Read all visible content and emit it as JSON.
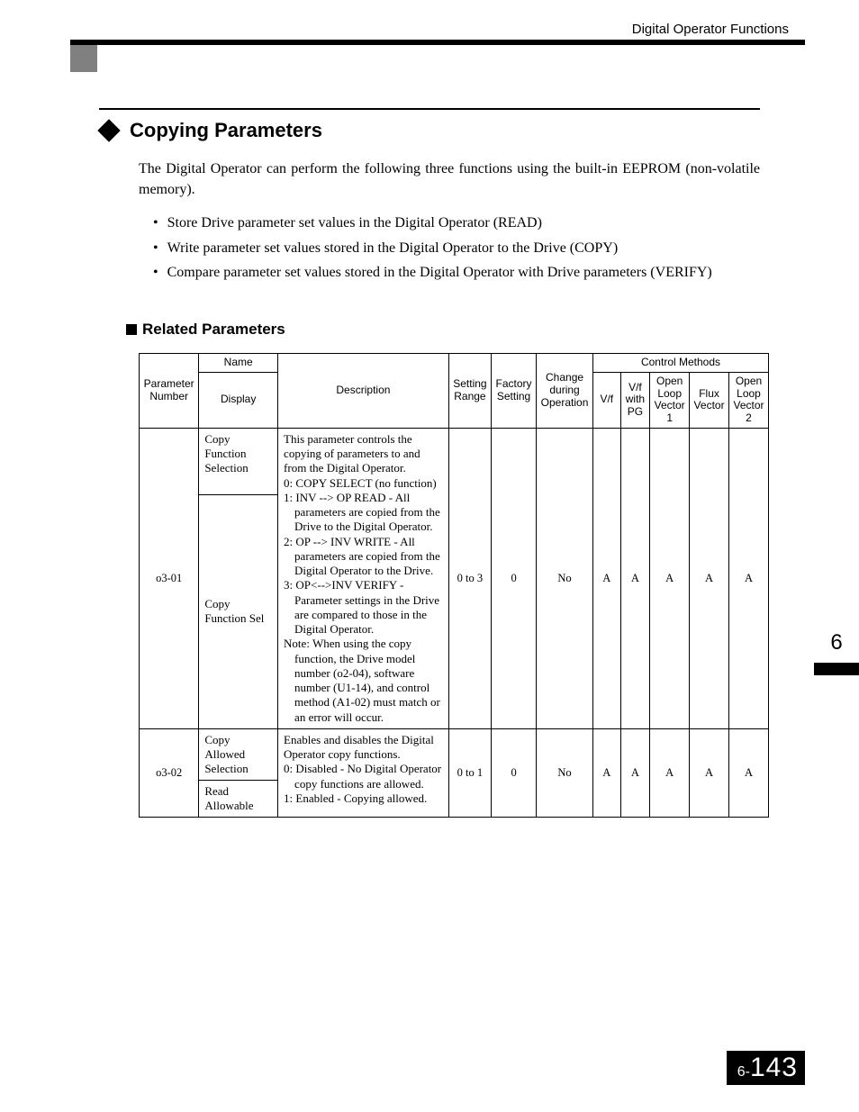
{
  "header": {
    "running_title": "Digital Operator Functions"
  },
  "section": {
    "title": "Copying Parameters",
    "intro": "The Digital Operator can perform the following three functions using the built-in EEPROM (non-volatile memory).",
    "bullets": [
      "Store Drive parameter set values in the Digital Operator (READ)",
      "Write parameter set values stored in the Digital Operator to the Drive (COPY)",
      "Compare parameter set values stored in the Digital Operator with Drive parameters (VERIFY)"
    ]
  },
  "subsection": {
    "title": "Related Parameters"
  },
  "table": {
    "head": {
      "param": "Parameter Number",
      "name": "Name",
      "display": "Display",
      "desc": "Description",
      "setting": "Setting Range",
      "factory": "Factory Setting",
      "change": "Change during Operation",
      "control": "Control Methods",
      "vf": "V/f",
      "vfpg": "V/f with PG",
      "olv1": "Open Loop Vector 1",
      "flux": "Flux Vector",
      "olv2": "Open Loop Vector 2"
    },
    "r1": {
      "param": "o3-01",
      "name": "Copy Function Selection",
      "display": "Copy Function Sel",
      "d0": "This parameter controls the copying of parameters to and from the Digital Operator.",
      "d1": "0: COPY SELECT (no function)",
      "d2": "1: INV --> OP READ - All parameters are copied from the Drive to the Digital Operator.",
      "d3": "2: OP --> INV WRITE - All parameters are copied from the Digital Operator to the Drive.",
      "d4": "3: OP<-->INV VERIFY - Parameter settings in the Drive are compared to those in the Digital Operator.",
      "d5": "Note: When using the copy function, the Drive model number (o2-04), software number (U1-14), and control method (A1-02) must match or an error will occur.",
      "setting": "0 to 3",
      "factory": "0",
      "change": "No",
      "vf": "A",
      "vfpg": "A",
      "olv1": "A",
      "flux": "A",
      "olv2": "A"
    },
    "r2": {
      "param": "o3-02",
      "name": "Copy Allowed Selection",
      "display": "Read Allowable",
      "d0": "Enables and disables the Digital Operator copy functions.",
      "d1": "0: Disabled - No Digital Operator copy functions are allowed.",
      "d2": "1: Enabled - Copying allowed.",
      "setting": "0 to 1",
      "factory": "0",
      "change": "No",
      "vf": "A",
      "vfpg": "A",
      "olv1": "A",
      "flux": "A",
      "olv2": "A"
    }
  },
  "tab": {
    "num": "6"
  },
  "footer": {
    "prefix": "6-",
    "page": "143"
  }
}
